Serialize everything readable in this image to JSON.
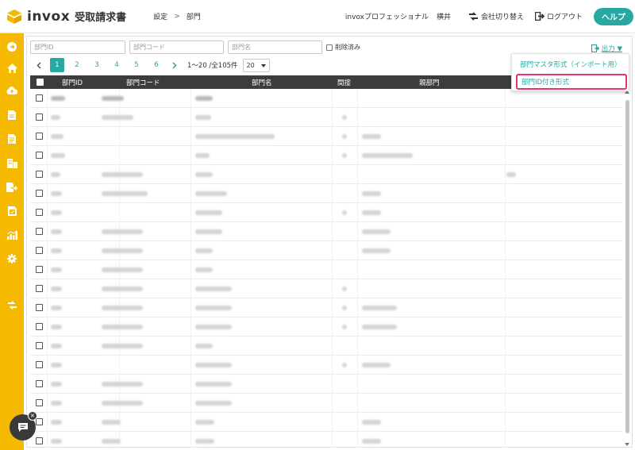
{
  "app": {
    "logo_text": "invox",
    "logo_sub": "受取請求書",
    "brand_color": "#27a8a0",
    "sidebar_color": "#f5b900"
  },
  "breadcrumb": {
    "items": [
      "設定",
      "部門"
    ],
    "separator": ">"
  },
  "header": {
    "company": "invoxプロフェッショナル",
    "user": "横井",
    "switch_company": "会社切り替え",
    "logout": "ログアウト",
    "help": "ヘルプ"
  },
  "sidebar": {
    "icons": [
      "arrow-right-circle-icon",
      "home-icon",
      "cloud-upload-icon",
      "document-icon",
      "document-list-icon",
      "building-icon",
      "document-export-icon",
      "document-check-icon",
      "chart-icon",
      "gear-icon",
      "switch-icon"
    ]
  },
  "filters": {
    "dept_id_placeholder": "部門ID",
    "dept_code_placeholder": "部門コード",
    "dept_name_placeholder": "部門名",
    "deleted_label": "削除済み"
  },
  "export": {
    "label": "出力 ▼",
    "options": [
      "部門マスタ形式（インポート用）",
      "部門ID付き形式"
    ]
  },
  "pagination": {
    "pages": [
      "1",
      "2",
      "3",
      "4",
      "5",
      "6"
    ],
    "current": "1",
    "info": "1〜20 /全105件",
    "per_page": "20"
  },
  "table": {
    "columns": [
      "部門ID",
      "部門コード",
      "部門名",
      "間接",
      "親部門",
      ""
    ],
    "row_count": 19
  },
  "chat": {
    "close_label": "×"
  }
}
